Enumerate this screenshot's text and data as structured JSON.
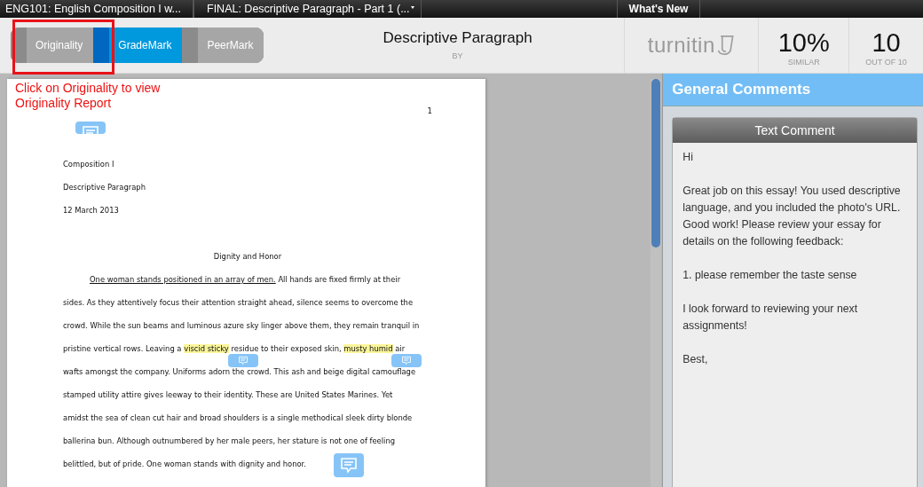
{
  "top_tabs": [
    {
      "label": "ENG101: English Composition I w...",
      "dropdown": false
    },
    {
      "label": "FINAL: Descriptive Paragraph - Part 1 (...",
      "dropdown": true
    },
    {
      "label": "What's New",
      "dropdown": false
    }
  ],
  "mode_switch": [
    {
      "label": "Originality",
      "selected": false
    },
    {
      "label": "GradeMark",
      "selected": true
    },
    {
      "label": "PeerMark",
      "selected": false
    }
  ],
  "annotation": {
    "text": "Click on Originality to view Originality Report"
  },
  "paper": {
    "title": "Descriptive Paragraph",
    "by": "BY"
  },
  "logo": "turnitin",
  "similarity": {
    "value": "10%",
    "label": "SIMILAR"
  },
  "grade": {
    "value": "10",
    "label": "OUT OF 10"
  },
  "document": {
    "page_number": "1",
    "heading_lines": [
      "Composition I",
      "Descriptive Paragraph",
      "12 March 2013"
    ],
    "title": "Dignity and Honor",
    "lines": [
      {
        "segments": [
          {
            "text": "One woman stands positioned in an array of men.",
            "kind": "underline"
          },
          {
            "text": " All hands are fixed firmly at their",
            "kind": "plain"
          }
        ]
      },
      {
        "segments": [
          {
            "text": "sides. As they attentively focus their attention straight ahead, silence seems to overcome the",
            "kind": "plain"
          }
        ]
      },
      {
        "segments": [
          {
            "text": "crowd. While the sun beams and luminous azure sky linger above them, they remain tranquil in",
            "kind": "plain"
          }
        ]
      },
      {
        "segments": [
          {
            "text": "pristine vertical rows. Leaving a ",
            "kind": "plain"
          },
          {
            "text": "viscid sticky",
            "kind": "highlight"
          },
          {
            "text": " residue to their exposed skin, ",
            "kind": "plain"
          },
          {
            "text": "musty humid",
            "kind": "highlight"
          },
          {
            "text": " air",
            "kind": "plain"
          }
        ]
      },
      {
        "segments": [
          {
            "text": "wafts amongst the company. Uniforms adorn the crowd. This ash and beige digital camouflage",
            "kind": "plain"
          }
        ]
      },
      {
        "segments": [
          {
            "text": "stamped utility attire gives leeway to their identity. These are United States Marines. Yet",
            "kind": "plain"
          }
        ]
      },
      {
        "segments": [
          {
            "text": "amidst the sea of clean cut hair and broad shoulders is a single methodical sleek dirty blonde",
            "kind": "plain"
          }
        ]
      },
      {
        "segments": [
          {
            "text": "ballerina bun. Although outnumbered by her male peers, her stature is not one of feeling",
            "kind": "plain"
          }
        ]
      },
      {
        "segments": [
          {
            "text": "belittled, but of pride. One woman stands with dignity and honor.",
            "kind": "plain"
          }
        ]
      }
    ]
  },
  "general_comments": {
    "title": "General Comments",
    "card_title": "Text Comment",
    "paragraphs": [
      "Hi",
      "Great job on this essay! You used descriptive language, and you included the photo's URL. Good work! Please review your essay for details on the following feedback:",
      "1. please remember the taste sense",
      "I look forward to reviewing your next assignments!",
      "Best,"
    ]
  }
}
